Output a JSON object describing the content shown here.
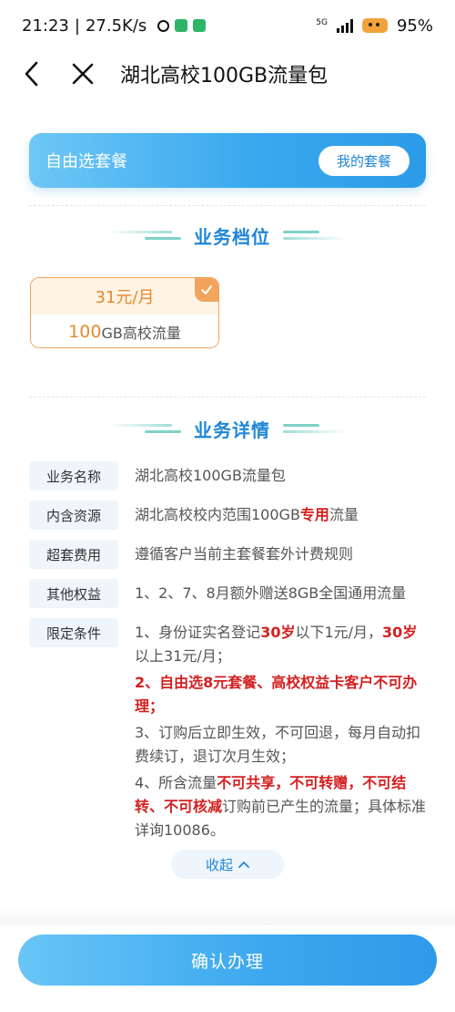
{
  "status_bar": {
    "time": "21:23",
    "separator": "|",
    "speed": "27.5K/s",
    "network": "5G",
    "battery": "95%"
  },
  "nav": {
    "title": "湖北高校100GB流量包",
    "back_icon": "chevron-left-icon",
    "close_icon": "close-icon"
  },
  "banner": {
    "title": "自由选套餐",
    "my_plan_button": "我的套餐"
  },
  "tier_section": {
    "title": "业务档位",
    "plan": {
      "price": "31元/月",
      "data_amount": "100",
      "data_text": "GB高校流量"
    }
  },
  "detail_section": {
    "title": "业务详情",
    "rows": [
      {
        "label": "业务名称",
        "value": "湖北高校100GB流量包"
      },
      {
        "label": "内含资源",
        "value_a": "湖北高校校内范围100GB",
        "value_red": "专用",
        "value_b": "流量"
      },
      {
        "label": "超套费用",
        "value": "遵循客户当前主套餐套外计费规则"
      },
      {
        "label": "其他权益",
        "value": "1、2、7、8月额外赠送8GB全国通用流量"
      }
    ],
    "conditions_label": "限定条件",
    "conditions": {
      "c1_a": "1、身份证实名登记",
      "c1_red1": "30岁",
      "c1_b": "以下1元/月，",
      "c1_red2": "30岁",
      "c1_c": "以上31元/月；",
      "c2": "2、自由选8元套餐、高校权益卡客户不可办理；",
      "c3": "3、订购后立即生效，不可回退，每月自动扣费续订，退订次月生效；",
      "c4_a": "4、所含流量",
      "c4_red1": "不可共享，不可转赠，不可结转、不可核减",
      "c4_b": "订购前已产生的流量；具体标准详询10086。"
    },
    "collapse_label": "收起"
  },
  "confirm_button": "确认办理",
  "colors": {
    "accent_blue": "#1f86d8",
    "orange": "#f2a45d",
    "red": "#d42020"
  }
}
